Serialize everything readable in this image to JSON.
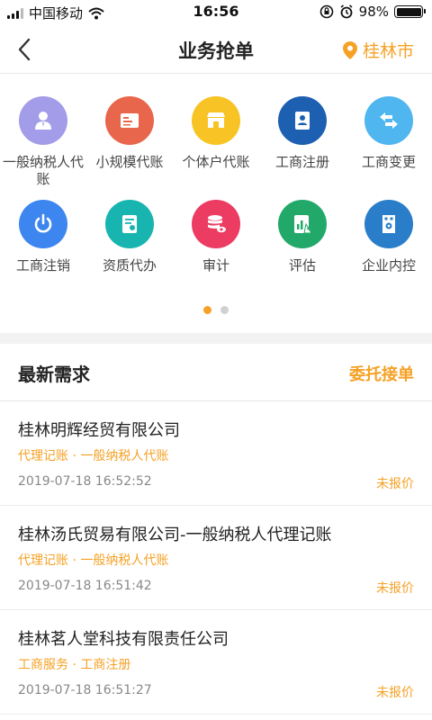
{
  "status_bar": {
    "carrier": "中国移动",
    "time": "16:56",
    "battery": "98%"
  },
  "navbar": {
    "title": "业务抢单",
    "location": "桂林市"
  },
  "services": [
    {
      "label": "一般纳税人代账",
      "icon": "person-icon",
      "color": "#a39ce8"
    },
    {
      "label": "小规模代账",
      "icon": "ledger-icon",
      "color": "#e8664c"
    },
    {
      "label": "个体户代账",
      "icon": "store-icon",
      "color": "#f7c325"
    },
    {
      "label": "工商注册",
      "icon": "registration-doc-icon",
      "color": "#1d5fb0"
    },
    {
      "label": "工商变更",
      "icon": "exchange-arrows-icon",
      "color": "#4fb6ef"
    },
    {
      "label": "工商注销",
      "icon": "power-icon",
      "color": "#3d86f0"
    },
    {
      "label": "资质代办",
      "icon": "certificate-icon",
      "color": "#18b5b0"
    },
    {
      "label": "审计",
      "icon": "database-eye-icon",
      "color": "#ec3c62"
    },
    {
      "label": "评估",
      "icon": "chart-doc-icon",
      "color": "#22a96a"
    },
    {
      "label": "企业内控",
      "icon": "building-gear-icon",
      "color": "#2a7ec9"
    }
  ],
  "pager": {
    "total": 2,
    "active": 1
  },
  "section": {
    "title": "最新需求",
    "action": "委托接单"
  },
  "demands": [
    {
      "company": "桂林明辉经贸有限公司",
      "tags": "代理记账 · 一般纳税人代账",
      "time": "2019-07-18 16:52:52",
      "status": "未报价"
    },
    {
      "company": "桂林汤氏贸易有限公司-一般纳税人代理记账",
      "tags": "代理记账 · 一般纳税人代账",
      "time": "2019-07-18 16:51:42",
      "status": "未报价"
    },
    {
      "company": "桂林茗人堂科技有限责任公司",
      "tags": "工商服务 · 工商注册",
      "time": "2019-07-18 16:51:27",
      "status": "未报价"
    }
  ],
  "colors": {
    "accent": "#f5a125"
  }
}
